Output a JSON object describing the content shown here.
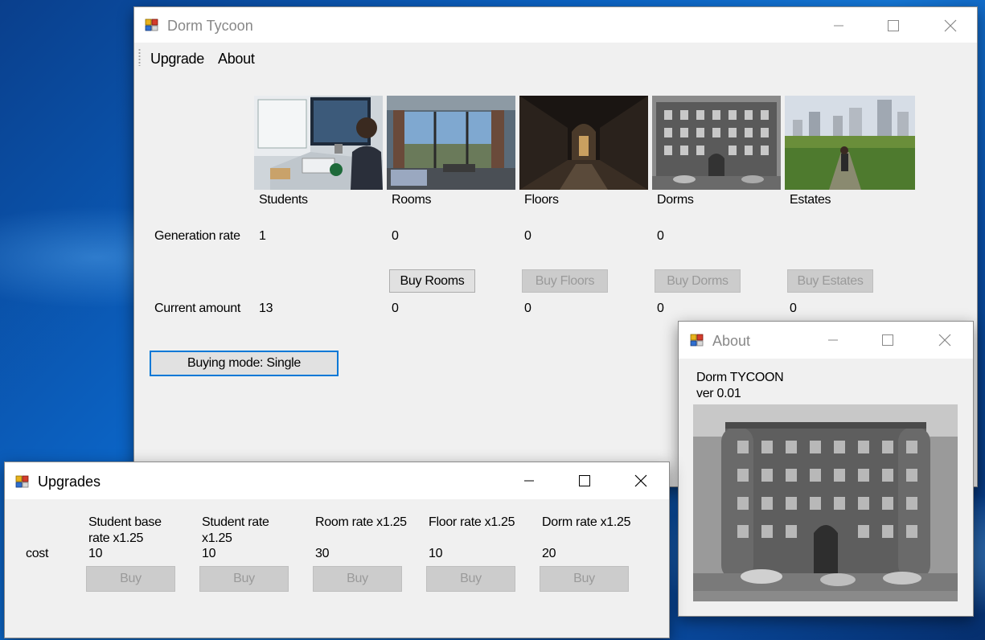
{
  "main_window": {
    "title": "Dorm Tycoon",
    "menu": [
      "Upgrade",
      "About"
    ],
    "columns": [
      "Students",
      "Rooms",
      "Floors",
      "Dorms",
      "Estates"
    ],
    "generation_rate_label": "Generation rate",
    "generation_rates": [
      "1",
      "0",
      "0",
      "0"
    ],
    "buttons": {
      "buy_rooms": "Buy Rooms",
      "buy_floors": "Buy Floors",
      "buy_dorms": "Buy Dorms",
      "buy_estates": "Buy Estates"
    },
    "current_amount_label": "Current amount",
    "current_amounts": [
      "13",
      "0",
      "0",
      "0",
      "0"
    ],
    "buying_mode": "Buying mode: Single"
  },
  "upgrades_window": {
    "title": "Upgrades",
    "cost_label": "cost",
    "items": [
      {
        "name_line1": "Student base",
        "name_line2": "rate x1.25",
        "cost": "10",
        "buy": "Buy"
      },
      {
        "name_line1": "Student rate",
        "name_line2": "x1.25",
        "cost": "10",
        "buy": "Buy"
      },
      {
        "name_line1": "Room rate x1.25",
        "name_line2": "",
        "cost": "30",
        "buy": "Buy"
      },
      {
        "name_line1": "Floor rate x1.25",
        "name_line2": "",
        "cost": "10",
        "buy": "Buy"
      },
      {
        "name_line1": "Dorm rate x1.25",
        "name_line2": "",
        "cost": "20",
        "buy": "Buy"
      }
    ]
  },
  "about_window": {
    "title": "About",
    "line1": "Dorm TYCOON",
    "line2": "ver 0.01"
  },
  "colors": {
    "focus_accent": "#0078d7",
    "disabled_text": "#9a9a9a",
    "window_bg": "#f0f0f0"
  },
  "icons": {
    "app_icon": "windows-forms-app-icon",
    "minimize": "minimize-icon",
    "maximize": "maximize-icon",
    "close": "close-icon"
  }
}
